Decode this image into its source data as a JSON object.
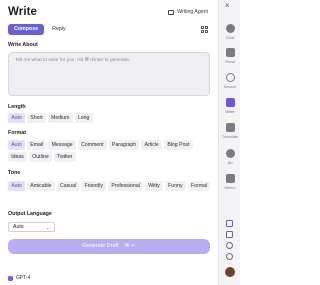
{
  "header": {
    "title": "Write",
    "agent_label": "Writing Agent",
    "tabs": [
      {
        "label": "Compose"
      },
      {
        "label": "Reply"
      }
    ]
  },
  "write_about": {
    "label": "Write About",
    "placeholder": "Tell me what to write for you. Hit ⌘+Enter to generate."
  },
  "length": {
    "label": "Length",
    "options": [
      "Auto",
      "Short",
      "Medium",
      "Long"
    ],
    "selected": "Auto"
  },
  "format": {
    "label": "Format",
    "options": [
      "Auto",
      "Email",
      "Message",
      "Comment",
      "Paragraph",
      "Article",
      "Blog Post",
      "Ideas",
      "Outline",
      "Twitter"
    ],
    "selected": "Auto"
  },
  "tone": {
    "label": "Tone",
    "options": [
      "Auto",
      "Amicable",
      "Casual",
      "Friendly",
      "Professional",
      "Witty",
      "Funny",
      "Formal"
    ],
    "selected": "Auto"
  },
  "output_language": {
    "label": "Output Language",
    "value": "Auto"
  },
  "generate_button": {
    "label": "Generate Draft",
    "shortcut": "⌘ ↵"
  },
  "model": {
    "label": "GPT-4"
  },
  "sidebar": {
    "items": [
      {
        "label": "Chat"
      },
      {
        "label": "Read"
      },
      {
        "label": "Search"
      },
      {
        "label": "Write"
      },
      {
        "label": "Translate"
      },
      {
        "label": "Art"
      },
      {
        "label": "Memo"
      }
    ]
  },
  "colors": {
    "accent": "#6b5fd6",
    "accent_light": "#e4e0fb",
    "button_disabled": "#b7adf3"
  }
}
